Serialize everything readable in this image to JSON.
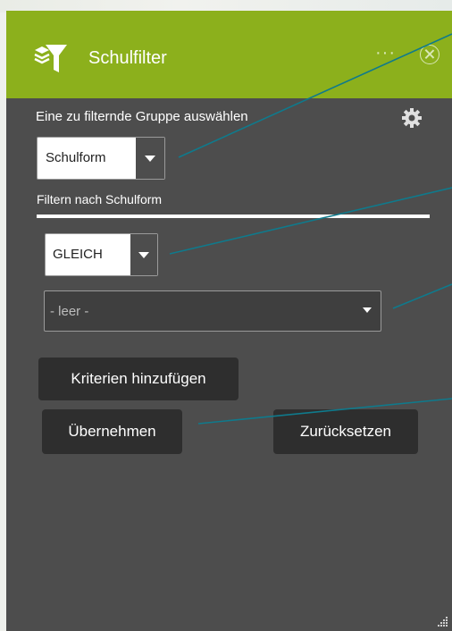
{
  "widget": {
    "title": "Schulfilter",
    "more_label": "···"
  },
  "filter": {
    "group_label": "Eine zu filternde Gruppe auswählen",
    "group_value": "Schulform",
    "filter_by_label": "Filtern nach Schulform",
    "operator_value": "GLEICH",
    "value_placeholder": "- leer -"
  },
  "buttons": {
    "add_criteria": "Kriterien hinzufügen",
    "apply": "Übernehmen",
    "reset": "Zurücksetzen"
  },
  "colors": {
    "header": "#8cb01c",
    "panel": "#4d4d4d",
    "button": "#2e2e2e",
    "callout_line": "#0f7a8c"
  },
  "icons": [
    "filter-layers-icon",
    "more-icon",
    "close-icon",
    "gear-icon",
    "chevron-down-icon",
    "resize-handle-icon"
  ]
}
